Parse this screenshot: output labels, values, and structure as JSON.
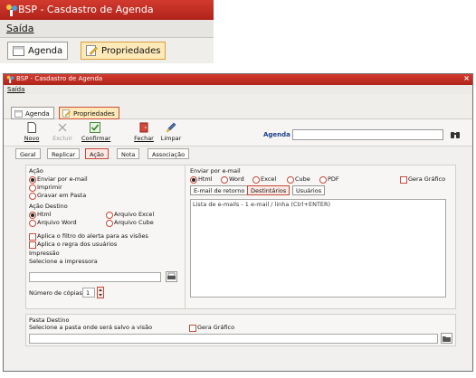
{
  "zoom": {
    "title": "BSP - Casdastro de Agenda",
    "menu": "Saída",
    "tabs": [
      {
        "label": "Agenda"
      },
      {
        "label": "Propriedades"
      }
    ]
  },
  "window": {
    "title": "BSP - Casdastro de Agenda",
    "close": "×",
    "menu": "Saída",
    "tabs": [
      {
        "label": "Agenda"
      },
      {
        "label": "Propriedades"
      }
    ]
  },
  "toolbar": {
    "buttons": [
      {
        "label": "Novo",
        "icon": "new-document-icon"
      },
      {
        "label": "Excluir",
        "icon": "delete-icon"
      },
      {
        "label": "Confirmar",
        "icon": "confirm-icon"
      },
      {
        "label": "Fechar",
        "icon": "close-door-icon"
      },
      {
        "label": "Limpar",
        "icon": "brush-icon"
      }
    ],
    "agenda_label": "Agenda",
    "agenda_value": ""
  },
  "subtabs": [
    "Geral",
    "Replicar",
    "Ação",
    "Nota",
    "Associação"
  ],
  "acao": {
    "title": "Ação",
    "options": [
      "Enviar por e-mail",
      "Imprimir",
      "Gravar em Pasta"
    ]
  },
  "acao_destino": {
    "title": "Ação Destino",
    "options": [
      "Html",
      "Arquivo Excel",
      "Arquivo Word",
      "Arquivo Cube"
    ]
  },
  "checks": [
    "Aplica o filtro do alerta para as visões",
    "Aplica o regra dos usuários"
  ],
  "impressao": {
    "title": "Impressão",
    "select_label": "Selecione a impressora",
    "printer_value": "",
    "copies_label": "Número de cópias",
    "copies_value": "1"
  },
  "email": {
    "title": "Enviar por e-mail",
    "formats": [
      "Html",
      "Word",
      "Excel",
      "Cube",
      "PDF"
    ],
    "gera_grafico": "Gera Gráfico",
    "buttons": [
      "E-mail de retorno",
      "Destintários",
      "Usuários"
    ],
    "list_header": "Lista de e-mails - 1 e-mail / linha (Ctrl+ENTER)"
  },
  "pasta": {
    "title": "Pasta Destino",
    "select_label": "Selecione a pasta onde será salvo a visão",
    "gera_grafico": "Gera Gráfico",
    "path_value": ""
  },
  "colors": {
    "titlebar": "#c2302a",
    "active_tab": "#ffe9b8",
    "accent": "#c44a3a"
  }
}
